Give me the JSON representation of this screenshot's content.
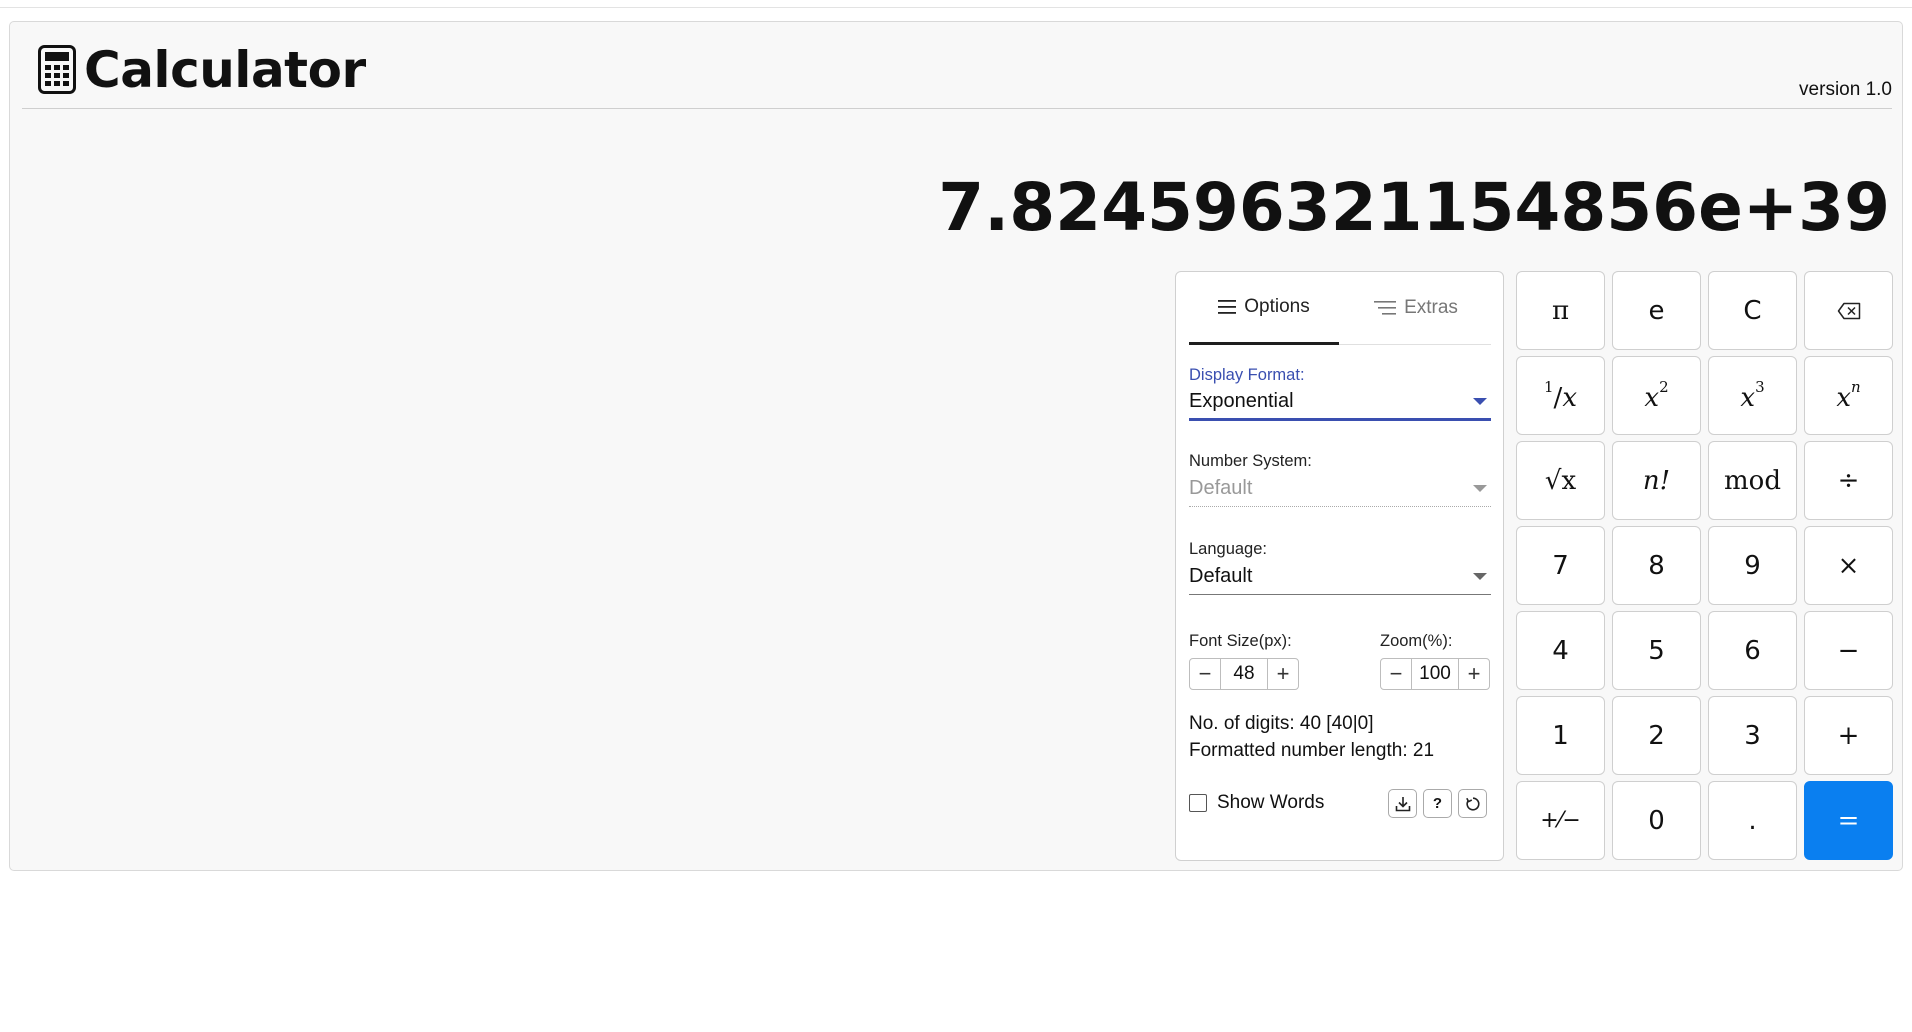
{
  "header": {
    "title": "Calculator",
    "version": "version 1.0",
    "logo_icon": "calculator-icon"
  },
  "display": {
    "value": "7.824596321154856e+39"
  },
  "tabs": [
    {
      "label": "Options",
      "icon": "menu-lines-icon",
      "active": true
    },
    {
      "label": "Extras",
      "icon": "sort-lines-icon",
      "active": false
    }
  ],
  "options": {
    "display_format": {
      "label": "Display Format:",
      "value": "Exponential"
    },
    "number_system": {
      "label": "Number System:",
      "value": "Default"
    },
    "language": {
      "label": "Language:",
      "value": "Default"
    },
    "font_size": {
      "label": "Font Size(px):",
      "value": "48",
      "minus": "−",
      "plus": "+"
    },
    "zoom": {
      "label": "Zoom(%):",
      "value": "100",
      "minus": "−",
      "plus": "+"
    },
    "digits_info": "No. of digits: 40 [40|0]",
    "length_info": "Formatted number length: 21",
    "show_words": {
      "label": "Show Words",
      "checked": false
    },
    "help_label": "?"
  },
  "keys": {
    "pi": "π",
    "e": "e",
    "clear": "C",
    "sqrt": "√x",
    "fact": "n!",
    "mod": "mod",
    "div": "÷",
    "seven": "7",
    "eight": "8",
    "nine": "9",
    "mul": "×",
    "four": "4",
    "five": "5",
    "six": "6",
    "sub": "−",
    "one": "1",
    "two": "2",
    "three": "3",
    "add": "+",
    "plusminus": "+⁄−",
    "zero": "0",
    "dot": ".",
    "equals": "="
  },
  "colors": {
    "accent": "#0a7ff0",
    "select_active": "#3a4fb0"
  }
}
